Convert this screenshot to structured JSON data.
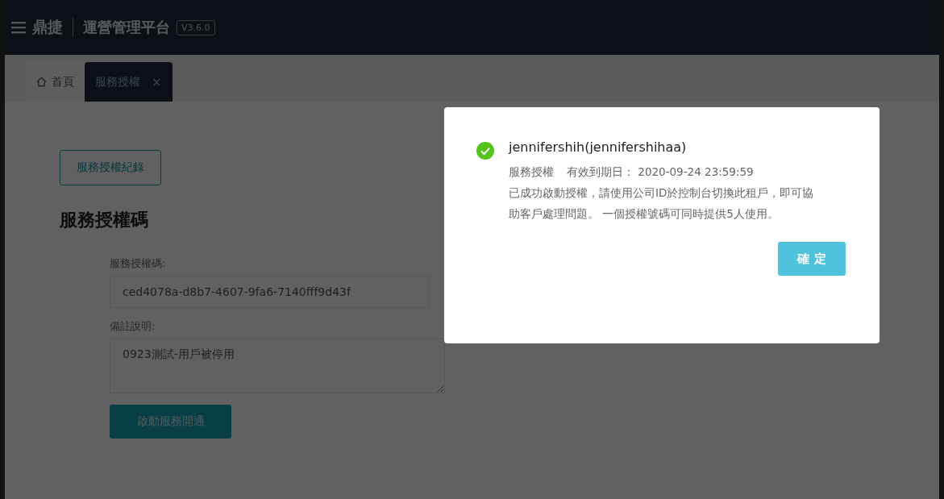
{
  "header": {
    "brand": "鼎捷",
    "title": "運營管理平台",
    "version": "V3.6.0"
  },
  "tabs": [
    {
      "label": "首頁",
      "kind": "home",
      "selected": false
    },
    {
      "label": "服務授權",
      "kind": "page",
      "selected": true,
      "close": "×"
    }
  ],
  "content": {
    "history_button": "服務授權紀錄",
    "heading": "服務授權碼",
    "fields": [
      {
        "label": "服務授權碼:",
        "kind": "input",
        "value": "ced4078a-d8b7-4607-9fa6-7140fff9d43f"
      },
      {
        "label": "備註說明:",
        "kind": "textarea",
        "value": "0923測試-用戶被停用"
      }
    ],
    "submit_button": "啟動服務開通"
  },
  "dialog": {
    "title": "jennifershih(jennifershihaa)",
    "service": "服務授權",
    "expiry": "有效到期日： 2020-09-24 23:59:59",
    "message": "已成功啟動授權，請使用公司ID於控制台切換此租戶，即可協助客戶處理問題。 一個授權號碼可同時提供5人使用。",
    "ok_button": "確 定"
  }
}
